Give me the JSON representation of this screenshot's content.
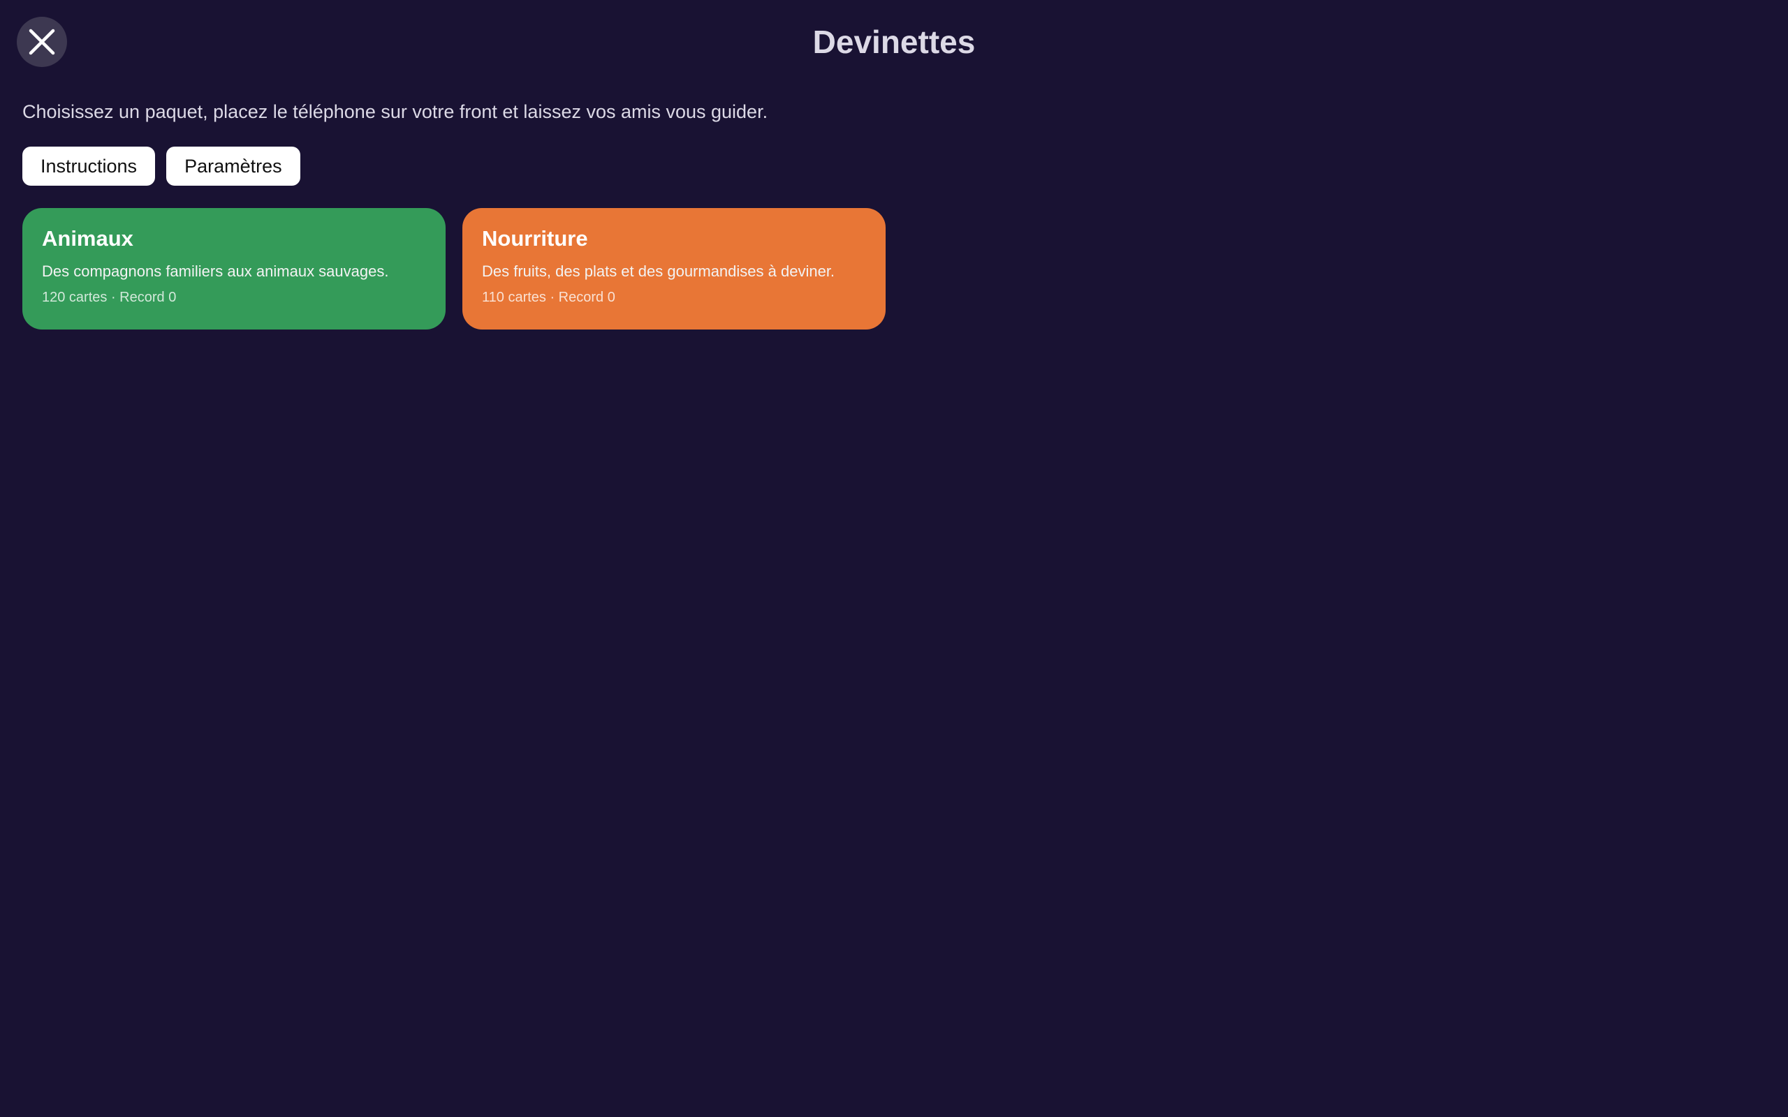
{
  "header": {
    "title": "Devinettes",
    "close_icon": "close-icon"
  },
  "intro": {
    "text": "Choisissez un paquet, placez le téléphone sur votre front et laissez vos amis vous guider."
  },
  "actions": {
    "instructions_label": "Instructions",
    "settings_label": "Paramètres"
  },
  "decks": [
    {
      "name": "Animaux",
      "description": "Des compagnons familiers aux animaux sauvages.",
      "meta": "120 cartes · Record 0",
      "color": "#349b59"
    },
    {
      "name": "Nourriture",
      "description": "Des fruits, des plats et des gourmandises à deviner.",
      "meta": "110 cartes · Record 0",
      "color": "#e87636"
    }
  ],
  "colors": {
    "background": "#191233",
    "close_button": "#3d3851",
    "text": "#dcd9e6"
  }
}
